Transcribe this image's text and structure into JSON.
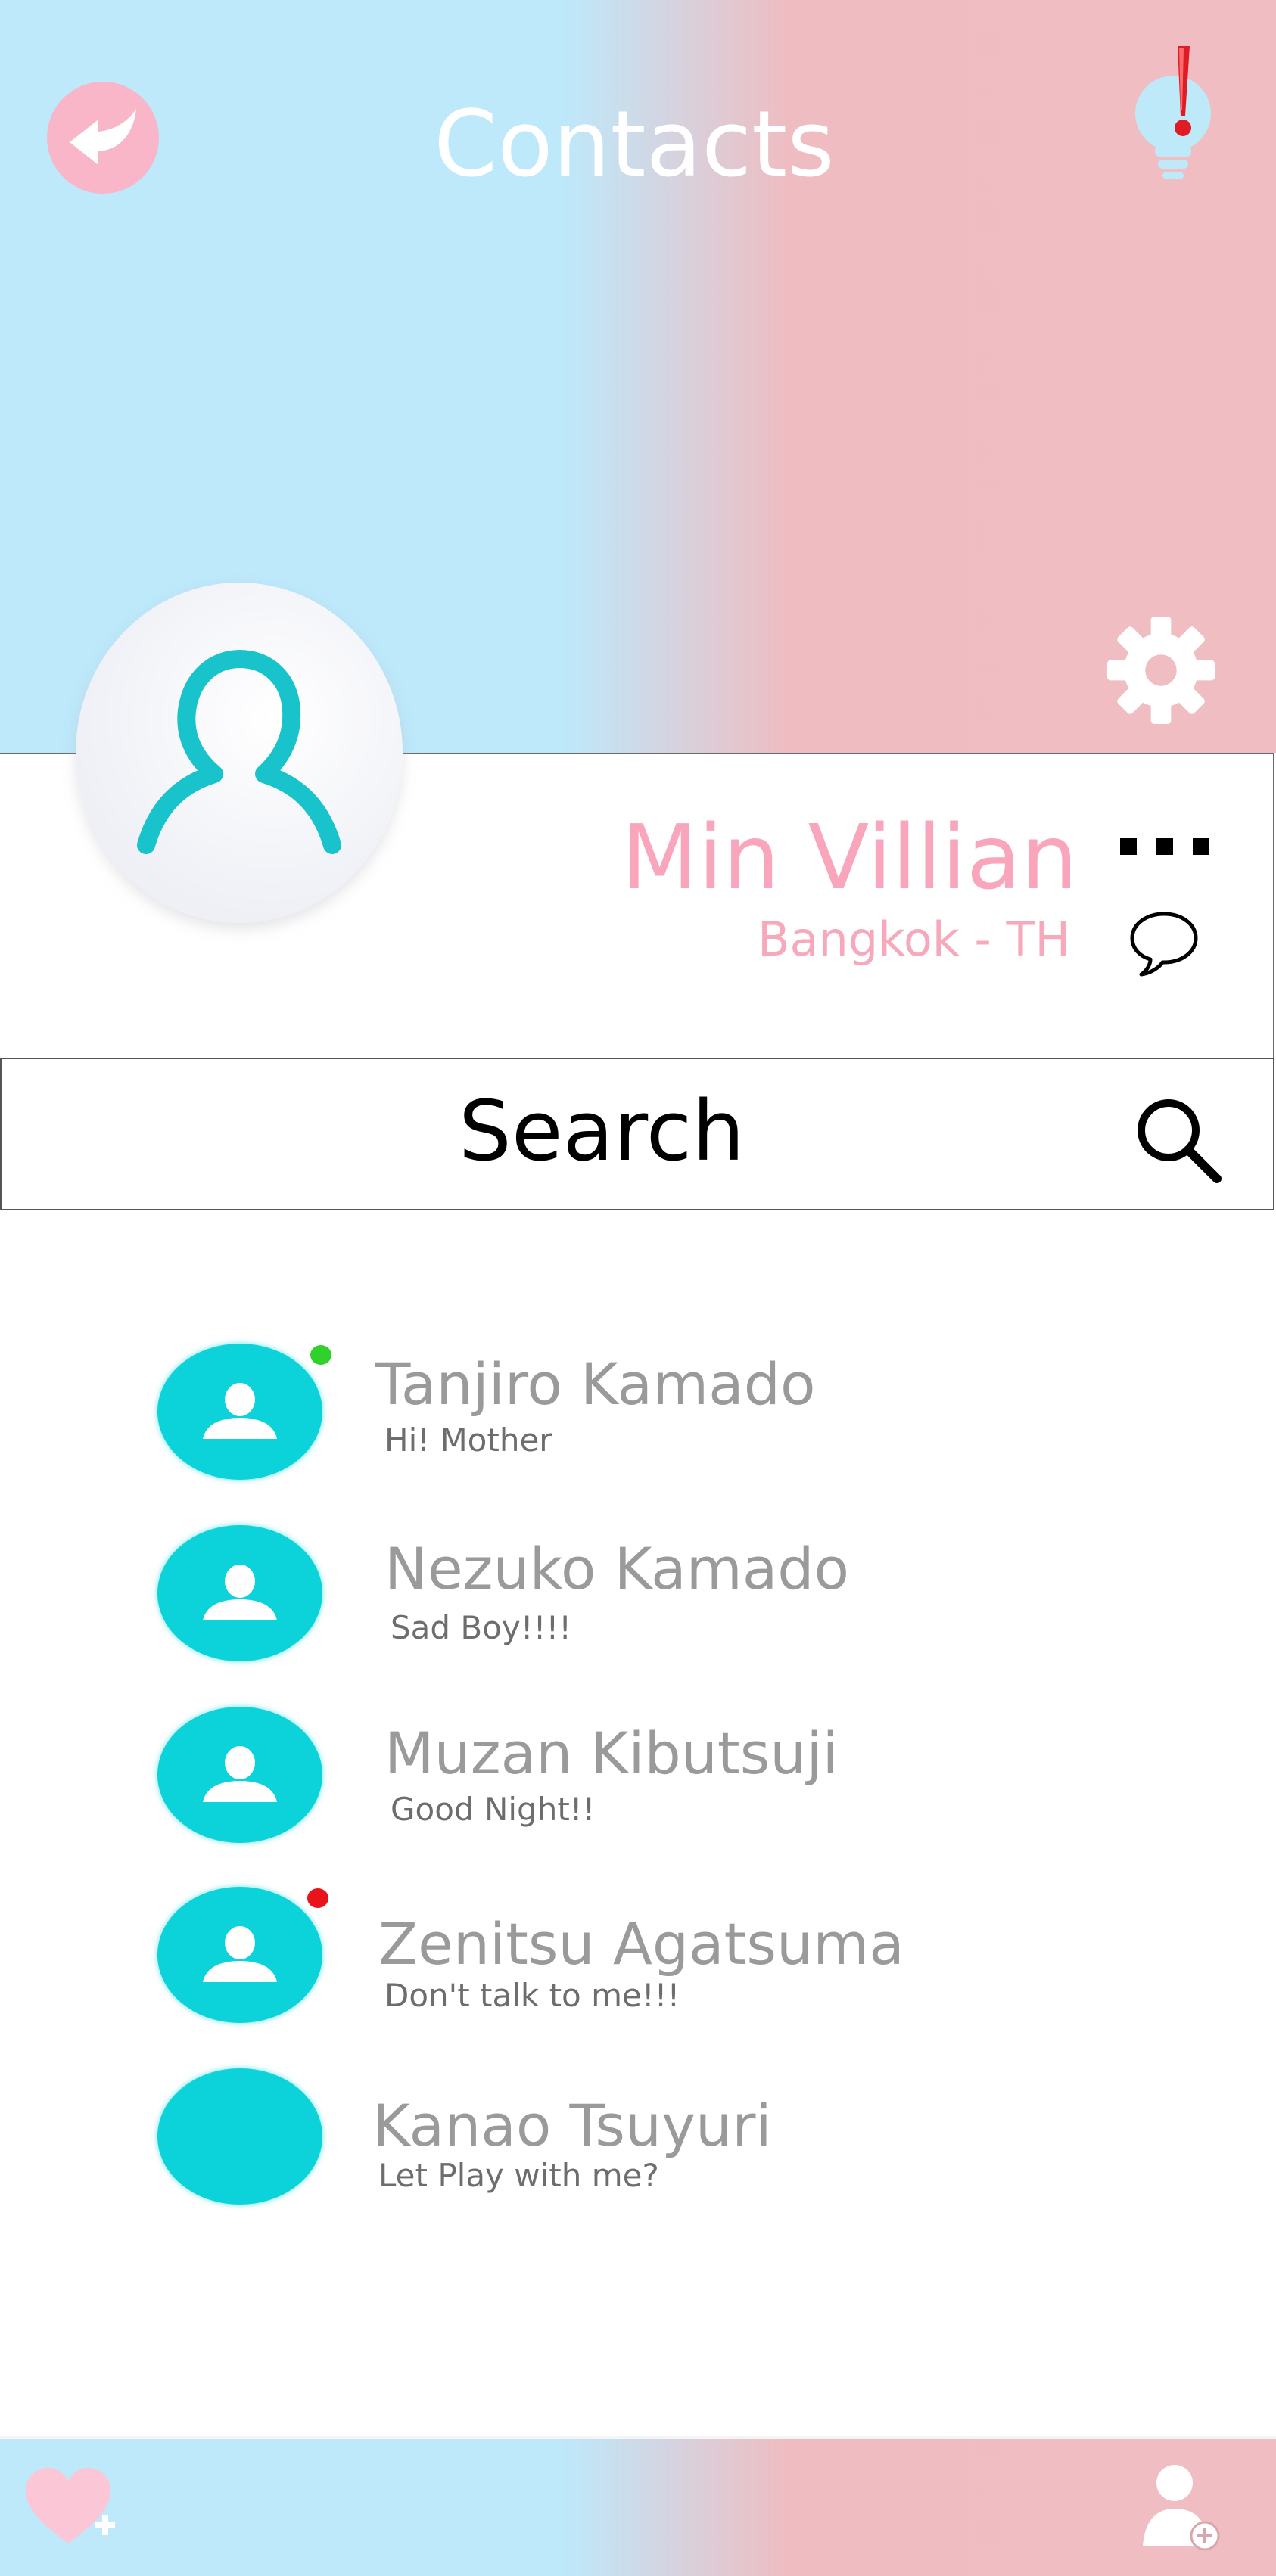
{
  "header": {
    "title": "Contacts"
  },
  "profile": {
    "name": "Min Villian",
    "location": "Bangkok - TH"
  },
  "search": {
    "label": "Search"
  },
  "contacts": [
    {
      "name": "Tanjiro Kamado",
      "message": "Hi! Mother",
      "status": "online",
      "status_color": "#2fd12a"
    },
    {
      "name": "Nezuko Kamado",
      "message": "Sad Boy!!!!",
      "status": "none"
    },
    {
      "name": "Muzan Kibutsuji",
      "message": "Good Night!!",
      "status": "none"
    },
    {
      "name": "Zenitsu Agatsuma",
      "message": "Don't talk to me!!!",
      "status": "busy",
      "status_color": "#e8141a"
    },
    {
      "name": "Kanao Tsuyuri",
      "message": "Let Play with me?",
      "status": "none"
    }
  ],
  "icons": {
    "back": "back-arrow-icon",
    "notification": "lightbulb-alert-icon",
    "settings": "gear-icon",
    "more": "more-dots-icon",
    "chat": "chat-bubble-icon",
    "search": "search-icon",
    "favorite_add": "heart-plus-icon",
    "add_contact": "add-user-icon"
  },
  "colors": {
    "accent_pink": "#f9a6bd",
    "avatar_cyan": "#0bd3d9",
    "header_blue": "#bde9fb",
    "header_pink": "#f0bec2"
  }
}
